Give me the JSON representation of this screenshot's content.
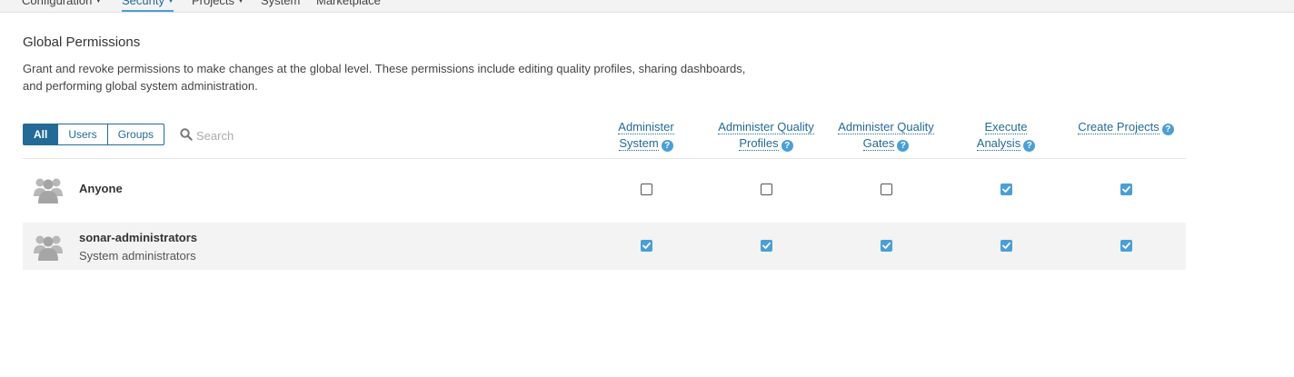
{
  "nav": {
    "items": [
      {
        "label": "Configuration",
        "caret": true
      },
      {
        "label": "Security",
        "caret": true,
        "active": true
      },
      {
        "label": "Projects",
        "caret": true
      },
      {
        "label": "System",
        "caret": false
      },
      {
        "label": "Marketplace",
        "caret": false
      }
    ]
  },
  "page": {
    "title": "Global Permissions",
    "description": "Grant and revoke permissions to make changes at the global level. These permissions include editing quality profiles, sharing dashboards, and performing global system administration."
  },
  "filters": {
    "all": "All",
    "users": "Users",
    "groups": "Groups",
    "selected": "All"
  },
  "search": {
    "placeholder": "Search",
    "value": ""
  },
  "columns": [
    {
      "line1": "Administer",
      "line2": "System"
    },
    {
      "line1": "Administer Quality",
      "line2": "Profiles"
    },
    {
      "line1": "Administer Quality",
      "line2": "Gates"
    },
    {
      "line1": "Execute",
      "line2": "Analysis"
    },
    {
      "line1": "Create Projects",
      "line2": ""
    }
  ],
  "groups": [
    {
      "name": "Anyone",
      "description": "",
      "permissions": [
        false,
        false,
        false,
        true,
        true
      ]
    },
    {
      "name": "sonar-administrators",
      "description": "System administrators",
      "permissions": [
        true,
        true,
        true,
        true,
        true
      ]
    }
  ],
  "colors": {
    "accent": "#236a97",
    "help": "#4b9fd5",
    "checked": "#4b9fd5"
  }
}
